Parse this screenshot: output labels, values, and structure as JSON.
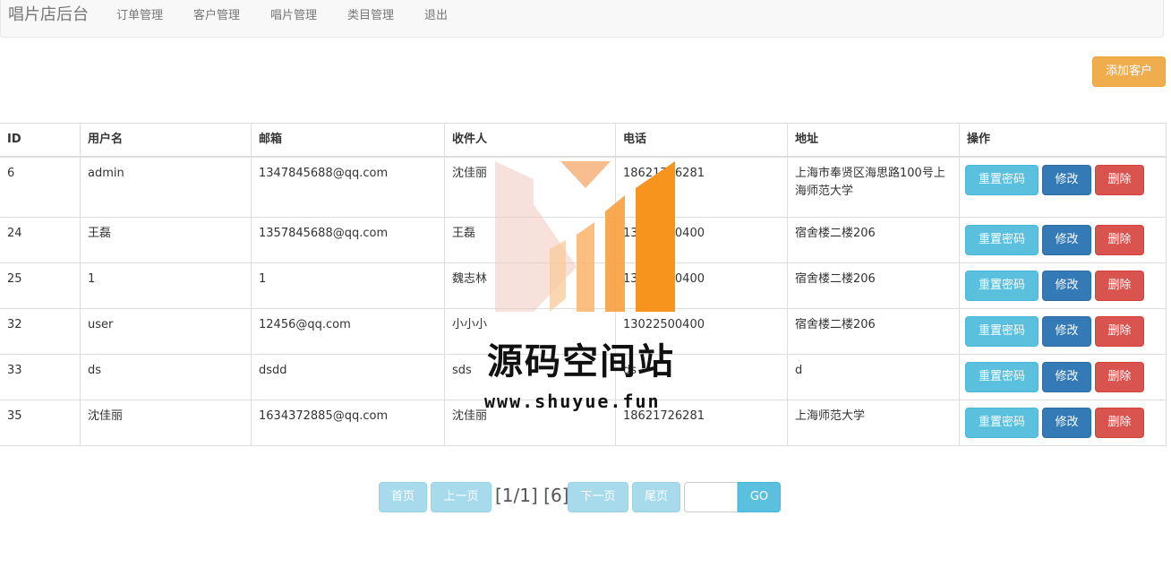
{
  "navbar": {
    "brand": "唱片店后台",
    "items": [
      "订单管理",
      "客户管理",
      "唱片管理",
      "类目管理",
      "退出"
    ]
  },
  "toolbar": {
    "add_customer_label": "添加客户"
  },
  "table": {
    "headers": [
      "ID",
      "用户名",
      "邮箱",
      "收件人",
      "电话",
      "地址",
      "操作"
    ],
    "rows": [
      {
        "id": "6",
        "username": "admin",
        "email": "1347845688@qq.com",
        "recipient": "沈佳丽",
        "phone": "18621726281",
        "address": "上海市奉贤区海思路100号上海师范大学"
      },
      {
        "id": "24",
        "username": "王磊",
        "email": "1357845688@qq.com",
        "recipient": "王磊",
        "phone": "13022500400",
        "address": "宿舍楼二楼206"
      },
      {
        "id": "25",
        "username": "1",
        "email": "1",
        "recipient": "魏志林",
        "phone": "13022500400",
        "address": "宿舍楼二楼206"
      },
      {
        "id": "32",
        "username": "user",
        "email": "12456@qq.com",
        "recipient": "小小小",
        "phone": "13022500400",
        "address": "宿舍楼二楼206"
      },
      {
        "id": "33",
        "username": "ds",
        "email": "dsdd",
        "recipient": "sds",
        "phone": "ds",
        "address": "d"
      },
      {
        "id": "35",
        "username": "沈佳丽",
        "email": "1634372885@qq.com",
        "recipient": "沈佳丽",
        "phone": "18621726281",
        "address": "上海师范大学"
      }
    ],
    "actions": {
      "reset": "重置密码",
      "edit": "修改",
      "delete": "删除"
    }
  },
  "pager": {
    "first": "首页",
    "prev": "上一页",
    "info": "[1/1] [6]",
    "next": "下一页",
    "last": "尾页",
    "page_input_value": "",
    "go": "GO"
  },
  "watermark": {
    "title": "源码空间站",
    "url": "www.shuyue.fun"
  },
  "colors": {
    "warning": "#f0ad4e",
    "info": "#5bc0de",
    "primary": "#337ab7",
    "danger": "#d9534f",
    "watermark_orange": "#f7941d"
  }
}
